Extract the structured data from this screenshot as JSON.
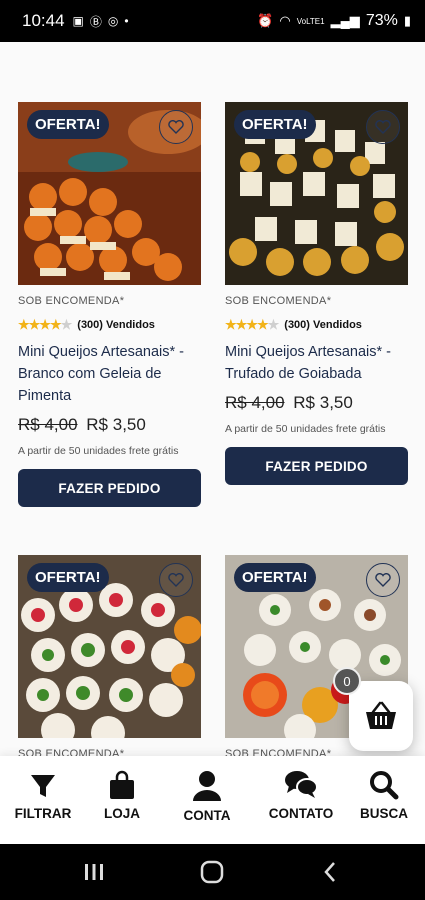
{
  "status_bar": {
    "time": "10:44",
    "battery": "73%",
    "network": "VoLTE1"
  },
  "products": [
    {
      "badge": "OFERTA!",
      "kind": "SOB ENCOMENDA*",
      "rating_value": 4,
      "rating_max": 5,
      "sold": "(300) Vendidos",
      "title": "Mini Queijos Artesanais* - Branco com Geleia de Pimenta",
      "old_price": "R$ 4,00",
      "price": "R$ 3,50",
      "note": "A partir de 50 unidades frete grátis",
      "button": "FAZER PEDIDO",
      "image": "orange-cheese-cups-photo"
    },
    {
      "badge": "OFERTA!",
      "kind": "SOB ENCOMENDA*",
      "rating_value": 4,
      "rating_max": 5,
      "sold": "(300) Vendidos",
      "title": "Mini Queijos Artesanais* - Trufado de Goiabada",
      "old_price": "R$ 4,00",
      "price": "R$ 3,50",
      "note": "A partir de 50 unidades frete grátis",
      "button": "FAZER PEDIDO",
      "image": "white-cheese-cups-photo"
    },
    {
      "badge": "OFERTA!",
      "kind": "SOB ENCOMENDA*",
      "image": "heart-cheese-cups-photo"
    },
    {
      "badge": "OFERTA!",
      "kind": "SOB ENCOMENDA*",
      "image": "garnished-cheese-cups-photo"
    }
  ],
  "cart": {
    "count": "0",
    "icon": "basket-icon"
  },
  "nav": [
    {
      "label": "FILTRAR",
      "icon": "filter-icon"
    },
    {
      "label": "LOJA",
      "icon": "shopping-bag-icon"
    },
    {
      "label": "CONTA",
      "icon": "user-icon"
    },
    {
      "label": "CONTATO",
      "icon": "chat-icon"
    },
    {
      "label": "BUSCA",
      "icon": "search-icon"
    }
  ],
  "colors": {
    "brand": "#1c2b4a",
    "star": "#f2b318"
  }
}
